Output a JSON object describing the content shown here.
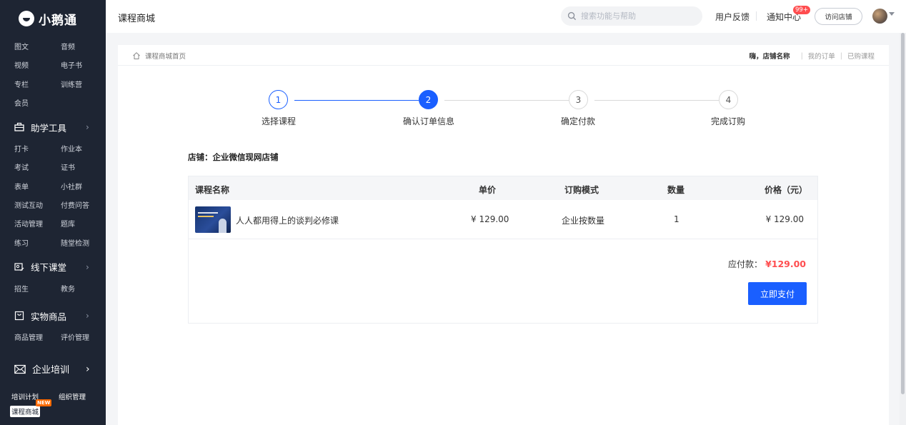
{
  "sidebar": {
    "brand": "小鹅通",
    "content_items": [
      "图文",
      "音频",
      "视频",
      "电子书",
      "专栏",
      "训练营",
      "会员"
    ],
    "sections": [
      {
        "label": "助学工具",
        "items": [
          "打卡",
          "作业本",
          "考试",
          "证书",
          "表单",
          "小社群",
          "测试互动",
          "付费问答",
          "活动管理",
          "题库",
          "练习",
          "随堂检测"
        ]
      },
      {
        "label": "线下课堂",
        "items": [
          "招生",
          "教务"
        ]
      },
      {
        "label": "实物商品",
        "items": [
          "商品管理",
          "评价管理"
        ]
      },
      {
        "label": "企业培训",
        "items": [
          "培训计划",
          "组织管理",
          "课程商城"
        ]
      }
    ],
    "new_badge": "NEW"
  },
  "header": {
    "title": "课程商城",
    "search_placeholder": "搜索功能与帮助",
    "feedback": "用户反馈",
    "notifications": "通知中心",
    "notification_count": "99+",
    "visit_store": "访问店铺"
  },
  "breadcrumb": {
    "home": "课程商城首页",
    "greeting": "嗨，店铺名称",
    "my_orders": "我的订单",
    "purchased": "已购课程"
  },
  "steps": [
    {
      "number": "1",
      "label": "选择课程",
      "state": "done"
    },
    {
      "number": "2",
      "label": "确认订单信息",
      "state": "active"
    },
    {
      "number": "3",
      "label": "确定付款",
      "state": "pending"
    },
    {
      "number": "4",
      "label": "完成订购",
      "state": "pending"
    }
  ],
  "order": {
    "store": "店铺：企业微信现网店铺",
    "columns": {
      "name": "课程名称",
      "unit_price": "单价",
      "mode": "订购模式",
      "quantity": "数量",
      "price": "价格（元）"
    },
    "rows": [
      {
        "name": "人人都用得上的谈判必修课",
        "unit_price": "¥ 129.00",
        "mode": "企业按数量",
        "quantity": "1",
        "price": "¥ 129.00"
      }
    ],
    "payable_label": "应付款：",
    "payable_amount": "¥129.00",
    "pay_button": "立即支付"
  },
  "colors": {
    "primary": "#1a5fff",
    "price_red": "#ff4d4f",
    "sidebar_bg": "#1e2533"
  }
}
